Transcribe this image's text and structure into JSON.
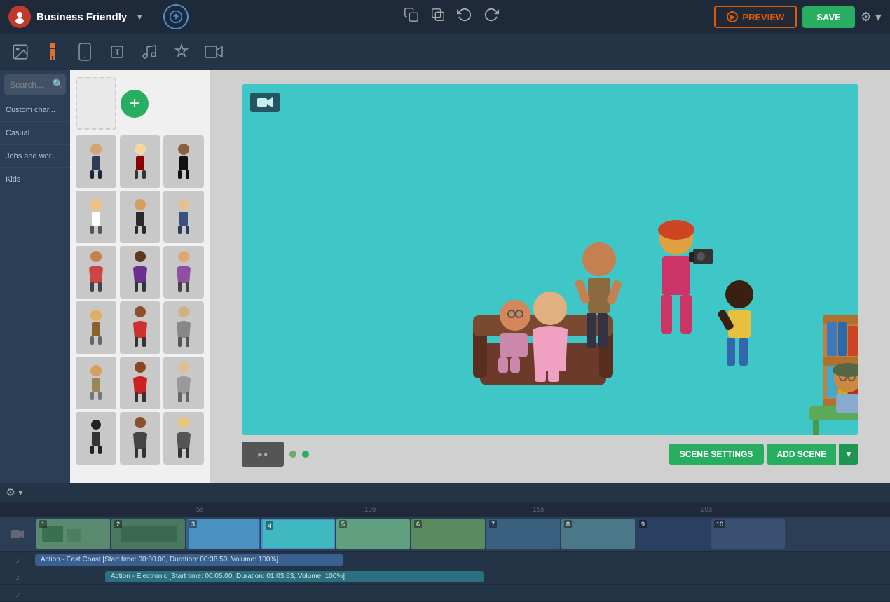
{
  "topbar": {
    "project_name": "Business Friendly",
    "preview_label": "PREVIEW",
    "save_label": "SAVE",
    "upload_title": "Upload"
  },
  "toolbar": {
    "items": [
      {
        "id": "image",
        "icon": "🖼",
        "label": "Image"
      },
      {
        "id": "character",
        "icon": "🚶",
        "label": "Character",
        "active": true
      },
      {
        "id": "device",
        "icon": "📱",
        "label": "Device"
      },
      {
        "id": "text",
        "icon": "T",
        "label": "Text"
      },
      {
        "id": "music",
        "icon": "♪",
        "label": "Music"
      },
      {
        "id": "effects",
        "icon": "✦",
        "label": "Effects"
      },
      {
        "id": "video",
        "icon": "▶",
        "label": "Video"
      }
    ]
  },
  "sidebar": {
    "search_placeholder": "Search...",
    "categories": [
      {
        "id": "custom",
        "label": "Custom char...",
        "active": false
      },
      {
        "id": "casual",
        "label": "Casual",
        "active": false
      },
      {
        "id": "jobs",
        "label": "Jobs and wor...",
        "active": false
      },
      {
        "id": "kids",
        "label": "Kids",
        "active": false
      }
    ]
  },
  "characters": {
    "rows": 7,
    "cols": 3
  },
  "canvas": {
    "camera_icon": "📹",
    "background_color": "#40c8c8"
  },
  "controls": {
    "scene_settings": "SCENE SETTINGS",
    "add_scene": "ADD SCENE"
  },
  "timeline": {
    "ruler_marks": [
      "5s",
      "10s",
      "15s",
      "20s"
    ],
    "audio_tracks": [
      {
        "label": "Action - East Coast [Start time: 00:00.00, Duration: 00:38.50, Volume: 100%]",
        "color": "blue",
        "offset": 0
      },
      {
        "label": "Action - Electronic [Start time: 00:05.00, Duration: 01:03.63, Volume: 100%]",
        "color": "teal",
        "offset": 100
      }
    ],
    "scenes": [
      {
        "num": "1"
      },
      {
        "num": "2"
      },
      {
        "num": "3"
      },
      {
        "num": "4",
        "active": true
      },
      {
        "num": "5"
      },
      {
        "num": "6"
      },
      {
        "num": "7"
      },
      {
        "num": "8"
      },
      {
        "num": "9"
      },
      {
        "num": "10"
      }
    ]
  }
}
